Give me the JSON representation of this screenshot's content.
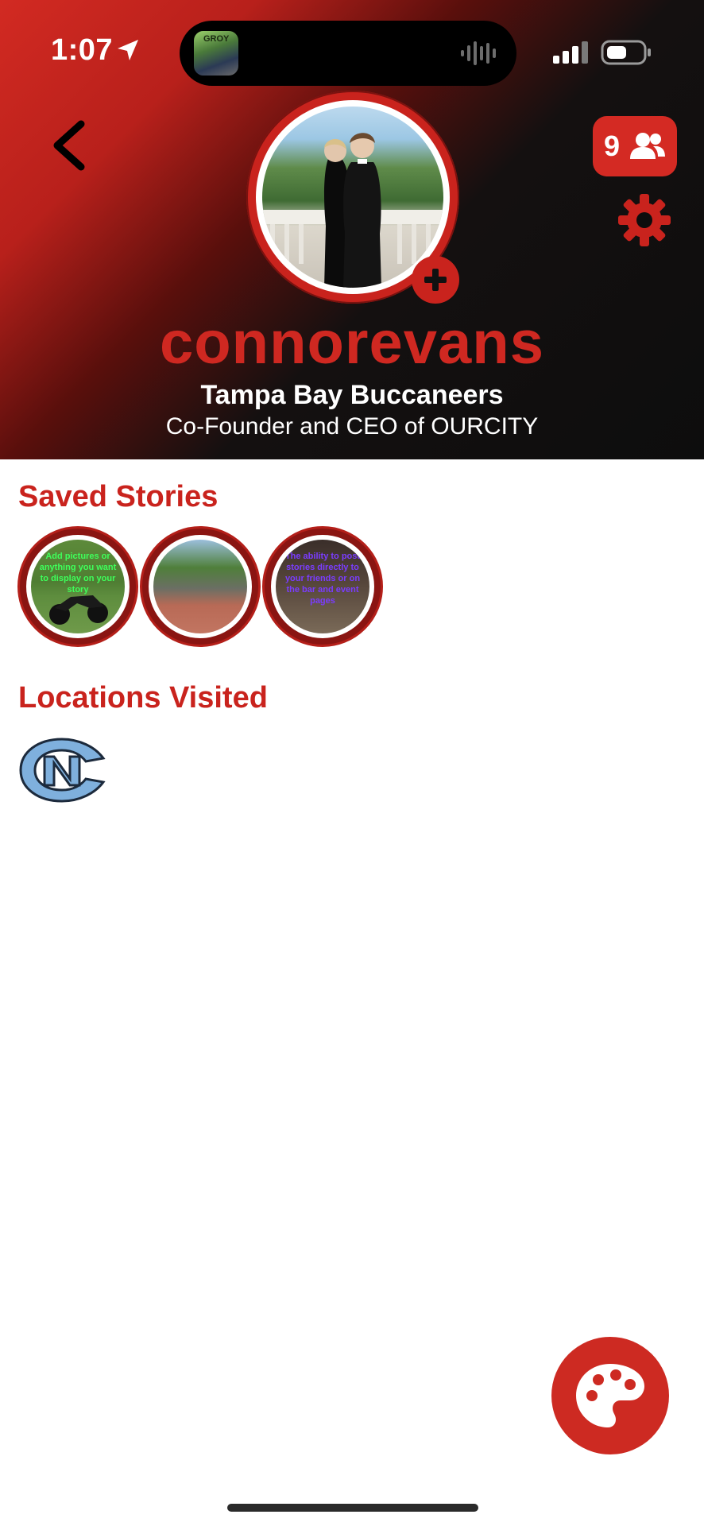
{
  "status_bar": {
    "time": "1:07",
    "island_art_text": "GROY"
  },
  "profile": {
    "friends_count": "9",
    "username": "connorevans",
    "team": "Tampa Bay Buccaneers",
    "bio": "Co-Founder and CEO of OURCITY"
  },
  "saved_stories": {
    "title": "Saved Stories",
    "items": [
      {
        "caption": "Add pictures or anything you want to display on your story"
      },
      {
        "caption": ""
      },
      {
        "caption": "The ability to post stories directly to your friends or on the bar and event pages"
      }
    ]
  },
  "locations": {
    "title": "Locations Visited"
  },
  "colors": {
    "brand_red": "#cf2821",
    "dark_red": "#8a1512",
    "unc_blue": "#7fb0dd"
  },
  "icons": {
    "back": "chevron-left-icon",
    "friends": "people-icon",
    "settings": "gear-icon",
    "add": "plus-icon",
    "palette": "palette-icon"
  }
}
